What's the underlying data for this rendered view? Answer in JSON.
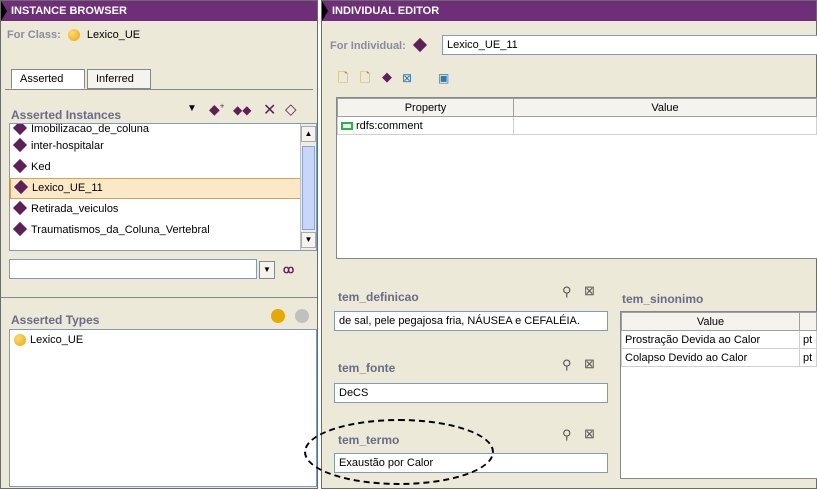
{
  "instance_browser": {
    "title": "INSTANCE BROWSER",
    "for_class_label": "For Class:",
    "for_class_value": "Lexico_UE",
    "tabs": [
      "Asserted",
      "Inferred"
    ],
    "asserted_instances_label": "Asserted Instances",
    "instances": [
      "Imobilizacao_de_coluna",
      "inter-hospitalar",
      "Ked",
      "Lexico_UE_11",
      "Retirada_veiculos",
      "Traumatismos_da_Coluna_Vertebral"
    ],
    "selected_instance": "Lexico_UE_11",
    "asserted_types_label": "Asserted Types",
    "types": [
      "Lexico_UE"
    ]
  },
  "individual_editor": {
    "title": "INDIVIDUAL EDITOR",
    "for_individual_label": "For Individual:",
    "for_individual_value": "Lexico_UE_11",
    "table_headers": [
      "Property",
      "Value"
    ],
    "properties": [
      {
        "property": "rdfs:comment",
        "value": ""
      }
    ],
    "tem_definicao": {
      "label": "tem_definicao",
      "value": "de sal, pele pegajosa fria, NÁUSEA e CEFALÉIA."
    },
    "tem_fonte": {
      "label": "tem_fonte",
      "value": "DeCS"
    },
    "tem_termo": {
      "label": "tem_termo",
      "value": "Exaustão por Calor"
    },
    "tem_sinonimo": {
      "label": "tem_sinonimo",
      "headers": [
        "Value",
        ""
      ],
      "rows": [
        {
          "value": "Prostração Devida ao Calor",
          "lang": "pt"
        },
        {
          "value": "Colapso Devido ao Calor",
          "lang": "pt"
        }
      ]
    }
  },
  "icons": {
    "search": "🔎",
    "delete": "⊠",
    "binoculars": "👓"
  }
}
